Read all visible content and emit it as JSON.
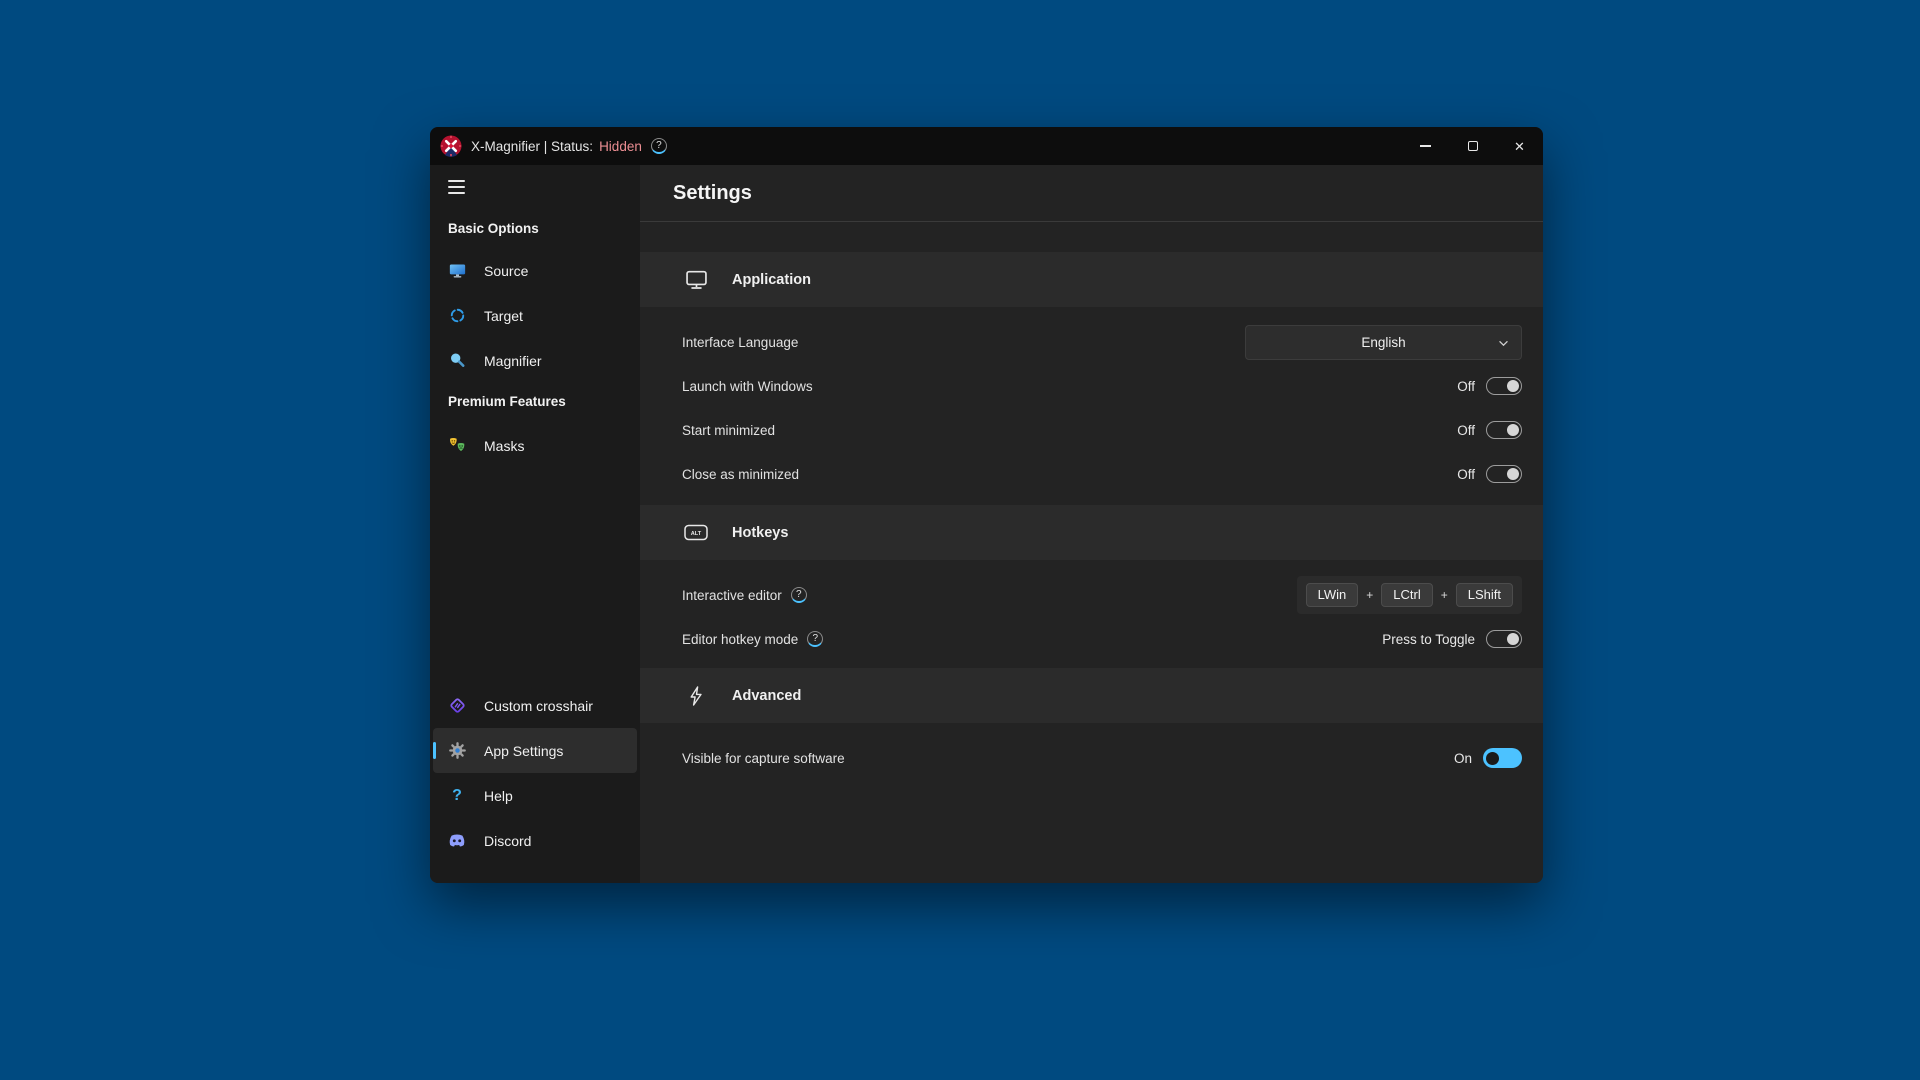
{
  "icons": {
    "close": "✕",
    "alt_key": "ALT",
    "help_glyph": "?"
  },
  "colors": {
    "desktop_bg": "#004a80",
    "titlebar_bg": "#0d0d0d",
    "sidebar_bg": "#1b1b1b",
    "main_bg": "#232323",
    "section_bar_bg": "#2b2b2b",
    "accent_blue": "#4cc2ff",
    "status_hidden": "#ec8e93"
  },
  "titlebar": {
    "title": "X-Magnifier | Status:",
    "status": "Hidden"
  },
  "sidebar": {
    "groups": {
      "basic": "Basic Options",
      "premium": "Premium Features"
    },
    "items": {
      "source": "Source",
      "target": "Target",
      "magnifier": "Magnifier",
      "masks": "Masks",
      "custom_crosshair": "Custom crosshair",
      "app_settings": "App Settings",
      "help": "Help",
      "discord": "Discord"
    }
  },
  "main": {
    "title": "Settings",
    "application": {
      "title": "Application",
      "interface_language": {
        "label": "Interface Language",
        "value": "English"
      },
      "launch_with_windows": {
        "label": "Launch with Windows",
        "state": "Off"
      },
      "start_minimized": {
        "label": "Start minimized",
        "state": "Off"
      },
      "close_as_minimized": {
        "label": "Close as minimized",
        "state": "Off"
      }
    },
    "hotkeys": {
      "title": "Hotkeys",
      "key_separator": "+",
      "interactive_editor": {
        "label": "Interactive editor",
        "keys": [
          "LWin",
          "LCtrl",
          "LShift"
        ]
      },
      "editor_hotkey_mode": {
        "label": "Editor hotkey mode",
        "state": "Press to Toggle"
      }
    },
    "advanced": {
      "title": "Advanced",
      "visible_for_capture": {
        "label": "Visible for capture software",
        "state": "On"
      }
    }
  }
}
